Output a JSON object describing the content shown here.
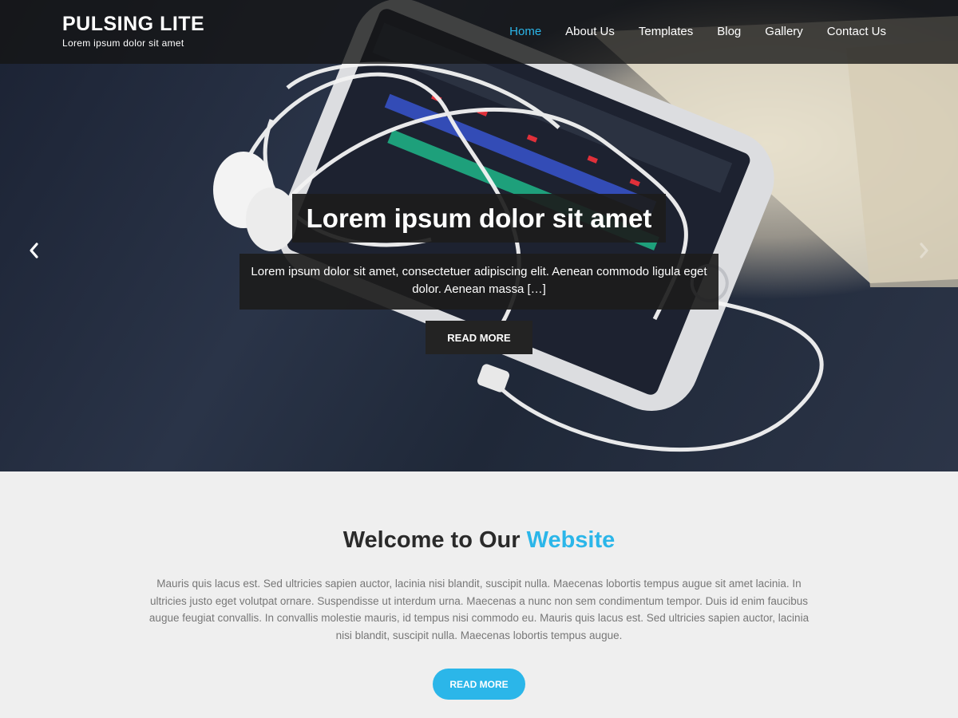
{
  "header": {
    "site_title": "PULSING LITE",
    "tagline": "Lorem ipsum dolor sit amet",
    "nav": [
      {
        "label": "Home",
        "active": true
      },
      {
        "label": "About Us"
      },
      {
        "label": "Templates"
      },
      {
        "label": "Blog"
      },
      {
        "label": "Gallery"
      },
      {
        "label": "Contact Us"
      }
    ]
  },
  "slider": {
    "title": "Lorem ipsum dolor sit amet",
    "description": "Lorem ipsum dolor sit amet, consectetuer adipiscing elit. Aenean commodo ligula eget dolor. Aenean massa […]",
    "button_label": "READ MORE",
    "prev_icon": "chevron-left-icon",
    "next_icon": "chevron-right-icon"
  },
  "welcome": {
    "heading_plain": "Welcome to Our",
    "heading_accent": "Website",
    "text": "Mauris quis lacus est. Sed ultricies sapien auctor, lacinia nisi blandit, suscipit nulla. Maecenas lobortis tempus augue sit amet lacinia. In ultricies justo eget volutpat ornare. Suspendisse ut interdum urna. Maecenas a nunc non sem condimentum tempor. Duis id enim faucibus augue feugiat convallis. In convallis molestie mauris, id tempus nisi commodo eu. Mauris quis lacus est. Sed ultricies sapien auctor, lacinia nisi blandit, suscipit nulla. Maecenas lobortis tempus augue.",
    "button_label": "READ MORE"
  },
  "colors": {
    "accent": "#2bb6e9",
    "header_bg": "#141414",
    "page_bg": "#efefef"
  }
}
